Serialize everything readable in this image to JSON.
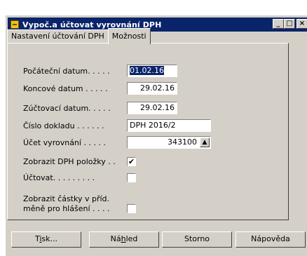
{
  "window": {
    "title": "Vypoč.a účtovat vyrovnání DPH",
    "controls": {
      "minimize": "_",
      "maximize": "□",
      "close": "×"
    }
  },
  "tabs": [
    {
      "label": "Nastavení účtování DPH",
      "active": false
    },
    {
      "label": "Možnosti",
      "active": true
    }
  ],
  "form": {
    "start_date": {
      "label": "Počáteční datum. . . . .",
      "value": "01.02.16"
    },
    "end_date": {
      "label": "Koncové datum . . . . .",
      "value": "29.02.16"
    },
    "posting_date": {
      "label": "Zúčtovací datum. . . . .",
      "value": "29.02.16"
    },
    "document_no": {
      "label": "Číslo dokladu . . . . . .",
      "value": "DPH 2016/2"
    },
    "settlement_account": {
      "label": "Účet vyrovnání . . . . .",
      "value": "343100"
    },
    "show_vat_entries": {
      "label": "Zobrazit DPH položky . .",
      "checked": true,
      "mark": "✔"
    },
    "post": {
      "label": "Účtovat. . . . . . . . .",
      "checked": false,
      "mark": ""
    },
    "show_amounts": {
      "label_line1": "Zobrazit částky v příd.",
      "label_line2": "měně pro hlášení . . . .",
      "checked": false,
      "mark": ""
    }
  },
  "buttons": {
    "print": {
      "label": "Tisk...",
      "pre": "T",
      "u": "i",
      "post": "sk..."
    },
    "preview": {
      "label": "Náhled",
      "pre": "Ná",
      "u": "h",
      "post": "led"
    },
    "cancel": {
      "label": "Storno"
    },
    "help": {
      "label": "Nápověda"
    }
  },
  "colors": {
    "titlebar": "#0a246a",
    "face": "#d4d0c8",
    "selection": "#0a246a"
  },
  "icons": {
    "app": "document-icon",
    "lookup": "up-arrow-icon"
  }
}
